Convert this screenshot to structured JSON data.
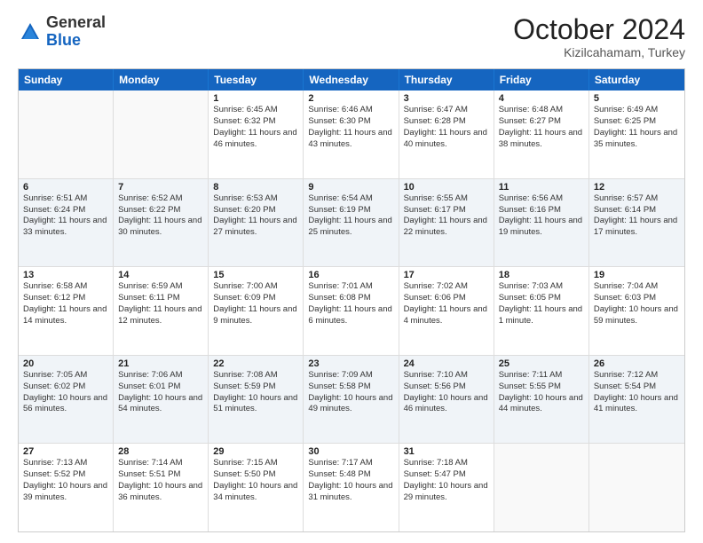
{
  "logo": {
    "general": "General",
    "blue": "Blue"
  },
  "header": {
    "month": "October 2024",
    "location": "Kizilcahamam, Turkey"
  },
  "days": [
    "Sunday",
    "Monday",
    "Tuesday",
    "Wednesday",
    "Thursday",
    "Friday",
    "Saturday"
  ],
  "rows": [
    [
      {
        "day": "",
        "lines": []
      },
      {
        "day": "",
        "lines": []
      },
      {
        "day": "1",
        "lines": [
          "Sunrise: 6:45 AM",
          "Sunset: 6:32 PM",
          "Daylight: 11 hours and 46 minutes."
        ]
      },
      {
        "day": "2",
        "lines": [
          "Sunrise: 6:46 AM",
          "Sunset: 6:30 PM",
          "Daylight: 11 hours and 43 minutes."
        ]
      },
      {
        "day": "3",
        "lines": [
          "Sunrise: 6:47 AM",
          "Sunset: 6:28 PM",
          "Daylight: 11 hours and 40 minutes."
        ]
      },
      {
        "day": "4",
        "lines": [
          "Sunrise: 6:48 AM",
          "Sunset: 6:27 PM",
          "Daylight: 11 hours and 38 minutes."
        ]
      },
      {
        "day": "5",
        "lines": [
          "Sunrise: 6:49 AM",
          "Sunset: 6:25 PM",
          "Daylight: 11 hours and 35 minutes."
        ]
      }
    ],
    [
      {
        "day": "6",
        "lines": [
          "Sunrise: 6:51 AM",
          "Sunset: 6:24 PM",
          "Daylight: 11 hours and 33 minutes."
        ]
      },
      {
        "day": "7",
        "lines": [
          "Sunrise: 6:52 AM",
          "Sunset: 6:22 PM",
          "Daylight: 11 hours and 30 minutes."
        ]
      },
      {
        "day": "8",
        "lines": [
          "Sunrise: 6:53 AM",
          "Sunset: 6:20 PM",
          "Daylight: 11 hours and 27 minutes."
        ]
      },
      {
        "day": "9",
        "lines": [
          "Sunrise: 6:54 AM",
          "Sunset: 6:19 PM",
          "Daylight: 11 hours and 25 minutes."
        ]
      },
      {
        "day": "10",
        "lines": [
          "Sunrise: 6:55 AM",
          "Sunset: 6:17 PM",
          "Daylight: 11 hours and 22 minutes."
        ]
      },
      {
        "day": "11",
        "lines": [
          "Sunrise: 6:56 AM",
          "Sunset: 6:16 PM",
          "Daylight: 11 hours and 19 minutes."
        ]
      },
      {
        "day": "12",
        "lines": [
          "Sunrise: 6:57 AM",
          "Sunset: 6:14 PM",
          "Daylight: 11 hours and 17 minutes."
        ]
      }
    ],
    [
      {
        "day": "13",
        "lines": [
          "Sunrise: 6:58 AM",
          "Sunset: 6:12 PM",
          "Daylight: 11 hours and 14 minutes."
        ]
      },
      {
        "day": "14",
        "lines": [
          "Sunrise: 6:59 AM",
          "Sunset: 6:11 PM",
          "Daylight: 11 hours and 12 minutes."
        ]
      },
      {
        "day": "15",
        "lines": [
          "Sunrise: 7:00 AM",
          "Sunset: 6:09 PM",
          "Daylight: 11 hours and 9 minutes."
        ]
      },
      {
        "day": "16",
        "lines": [
          "Sunrise: 7:01 AM",
          "Sunset: 6:08 PM",
          "Daylight: 11 hours and 6 minutes."
        ]
      },
      {
        "day": "17",
        "lines": [
          "Sunrise: 7:02 AM",
          "Sunset: 6:06 PM",
          "Daylight: 11 hours and 4 minutes."
        ]
      },
      {
        "day": "18",
        "lines": [
          "Sunrise: 7:03 AM",
          "Sunset: 6:05 PM",
          "Daylight: 11 hours and 1 minute."
        ]
      },
      {
        "day": "19",
        "lines": [
          "Sunrise: 7:04 AM",
          "Sunset: 6:03 PM",
          "Daylight: 10 hours and 59 minutes."
        ]
      }
    ],
    [
      {
        "day": "20",
        "lines": [
          "Sunrise: 7:05 AM",
          "Sunset: 6:02 PM",
          "Daylight: 10 hours and 56 minutes."
        ]
      },
      {
        "day": "21",
        "lines": [
          "Sunrise: 7:06 AM",
          "Sunset: 6:01 PM",
          "Daylight: 10 hours and 54 minutes."
        ]
      },
      {
        "day": "22",
        "lines": [
          "Sunrise: 7:08 AM",
          "Sunset: 5:59 PM",
          "Daylight: 10 hours and 51 minutes."
        ]
      },
      {
        "day": "23",
        "lines": [
          "Sunrise: 7:09 AM",
          "Sunset: 5:58 PM",
          "Daylight: 10 hours and 49 minutes."
        ]
      },
      {
        "day": "24",
        "lines": [
          "Sunrise: 7:10 AM",
          "Sunset: 5:56 PM",
          "Daylight: 10 hours and 46 minutes."
        ]
      },
      {
        "day": "25",
        "lines": [
          "Sunrise: 7:11 AM",
          "Sunset: 5:55 PM",
          "Daylight: 10 hours and 44 minutes."
        ]
      },
      {
        "day": "26",
        "lines": [
          "Sunrise: 7:12 AM",
          "Sunset: 5:54 PM",
          "Daylight: 10 hours and 41 minutes."
        ]
      }
    ],
    [
      {
        "day": "27",
        "lines": [
          "Sunrise: 7:13 AM",
          "Sunset: 5:52 PM",
          "Daylight: 10 hours and 39 minutes."
        ]
      },
      {
        "day": "28",
        "lines": [
          "Sunrise: 7:14 AM",
          "Sunset: 5:51 PM",
          "Daylight: 10 hours and 36 minutes."
        ]
      },
      {
        "day": "29",
        "lines": [
          "Sunrise: 7:15 AM",
          "Sunset: 5:50 PM",
          "Daylight: 10 hours and 34 minutes."
        ]
      },
      {
        "day": "30",
        "lines": [
          "Sunrise: 7:17 AM",
          "Sunset: 5:48 PM",
          "Daylight: 10 hours and 31 minutes."
        ]
      },
      {
        "day": "31",
        "lines": [
          "Sunrise: 7:18 AM",
          "Sunset: 5:47 PM",
          "Daylight: 10 hours and 29 minutes."
        ]
      },
      {
        "day": "",
        "lines": []
      },
      {
        "day": "",
        "lines": []
      }
    ]
  ]
}
